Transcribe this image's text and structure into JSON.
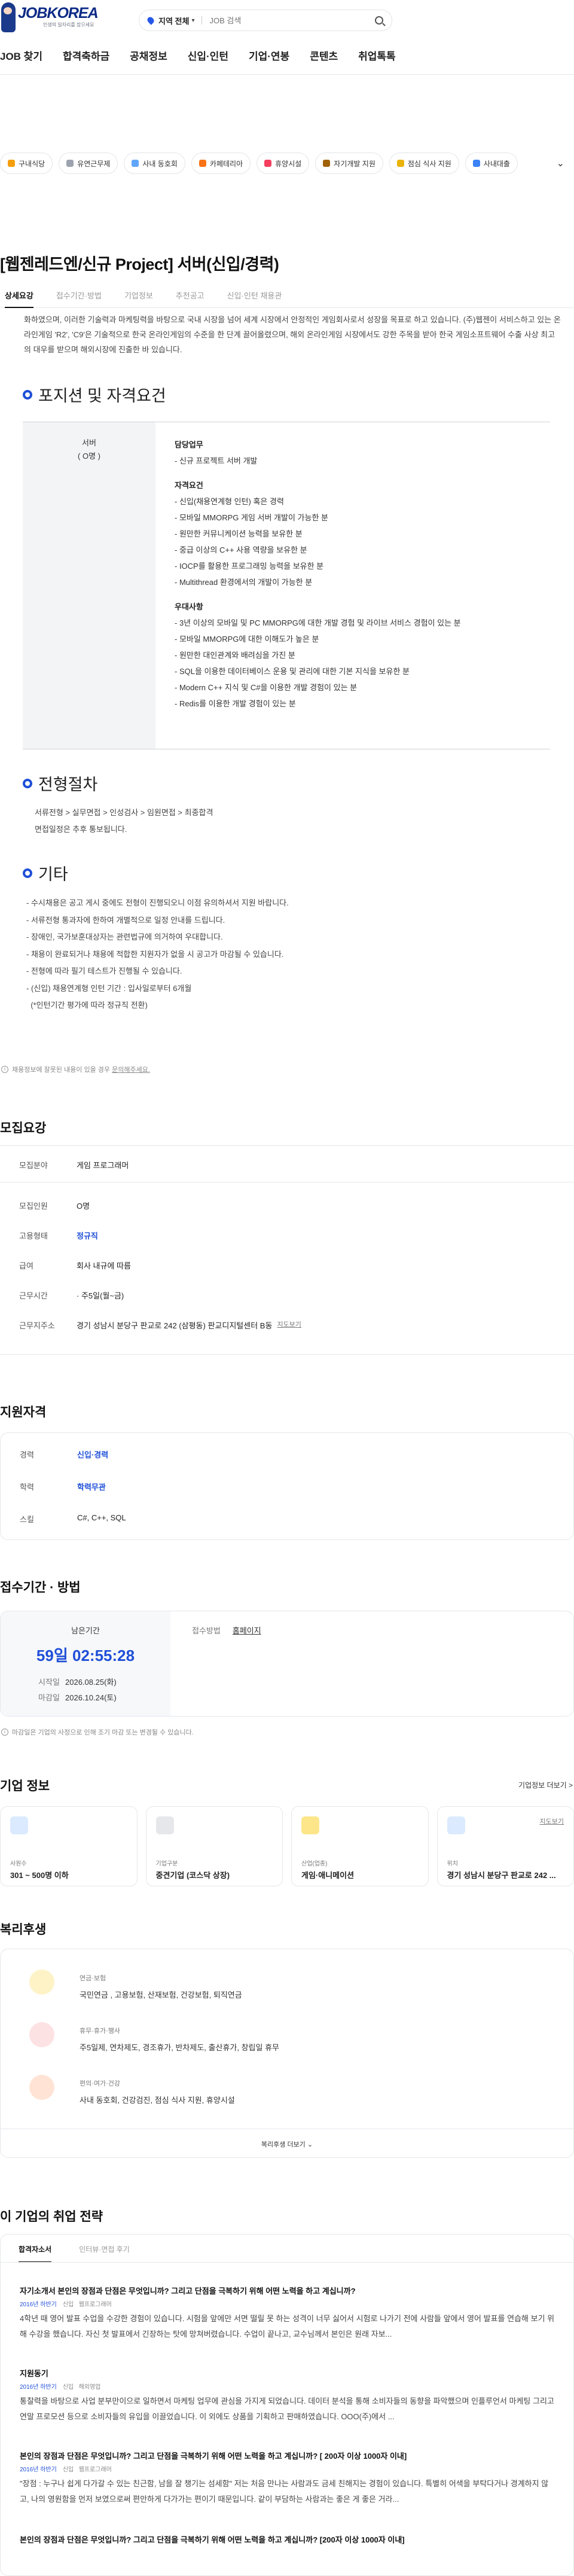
{
  "header": {
    "brand": "JOBKOREA",
    "brand_sub": "인생의 일자리를 잡으세요",
    "region_label": "지역 전체",
    "search_placeholder": "JOB 검색",
    "gnb": [
      "JOB 찾기",
      "합격축하금",
      "공채정보",
      "신입·인턴",
      "기업·연봉",
      "콘텐츠",
      "취업톡톡"
    ]
  },
  "chips": [
    {
      "label": "구내식당",
      "color": "#f59e0b"
    },
    {
      "label": "유연근무제",
      "color": "#9ca3af"
    },
    {
      "label": "사내 동호회",
      "color": "#60a5fa"
    },
    {
      "label": "카페테리아",
      "color": "#f97316"
    },
    {
      "label": "휴양시설",
      "color": "#f43f5e"
    },
    {
      "label": "자기개발 지원",
      "color": "#a16207"
    },
    {
      "label": "점심 식사 지원",
      "color": "#eab308"
    },
    {
      "label": "사내대출",
      "color": "#3b82f6"
    }
  ],
  "job": {
    "title": "[웹젠레드엔/신규 Project] 서버(신입/경력)",
    "tabs": [
      "상세요강",
      "접수기간·방법",
      "기업정보",
      "추천공고",
      "신입·인턴 채용관"
    ],
    "intro": "화하였으며, 이러한 기술력과 마케팅력을 바탕으로 국내 시장을 넘어 세계 시장에서 안정적인 게임회사로서 성장을 목표로 하고 있습니다. (주)웹젠이 서비스하고 있는 온라인게임 'R2', 'C9'은 기술적으로 한국 온라인게임의 수준을 한 단계 끌어올렸으며, 해외 온라인게임 시장에서도 강한 주목을 받아 한국 게임소프트웨어 수출 사상 최고의 대우를 받으며 해외시장에 진출한 바 있습니다.",
    "section_qual": "포지션 및 자격요건",
    "pos_name": "서버",
    "pos_count": "( O명 )",
    "duty_head": "담당업무",
    "duty": "- 신규 프로젝트 서버 개발",
    "qual_head": "자격요건",
    "quals": [
      "- 신입(채용연계형 인턴) 혹은 경력",
      "- 모바일 MMORPG 게임 서버 개발이 가능한 분",
      "- 원만한 커뮤니케이션 능력을 보유한 분",
      "- 중급 이상의 C++ 사용 역량을 보유한 분",
      "- IOCP를 활용한 프로그래밍 능력을 보유한 분",
      "- Multithread 환경에서의 개발이 가능한 분"
    ],
    "pref_head": "우대사항",
    "prefs": [
      "- 3년 이상의 모바일 및 PC MMORPG에 대한 개발 경험 및 라이브 서비스 경험이 있는 분",
      "- 모바일 MMORPG에 대한 이해도가 높은 분",
      "- 원만한 대인관계와 배려심을 가진 분",
      "- SQL을 이용한 데이터베이스 운용 및 관리에 대한 기본 지식을 보유한 분",
      "- Modern C++ 지식 및 C#을 이용한 개발 경험이 있는 분",
      "- Redis를 이용한 개발 경험이 있는 분"
    ],
    "section_proc": "전형절차",
    "proc": [
      "서류전형 > 실무면접 > 인성검사 > 임원면접 > 최종합격",
      "면접일정은 추후 통보됩니다."
    ],
    "section_etc": "기타",
    "etc": [
      "- 수시채용은 공고 게시 중에도 전형이 진행되오니 이점 유의하셔서 지원 바랍니다.",
      "- 서류전형 통과자에 한하여 개별적으로 일정 안내를 드립니다.",
      "- 장애인, 국가보훈대상자는 관련법규에 의거하여 우대합니다.",
      "- 채용이 완료되거나 채용에 적합한 지원자가 없을 시 공고가 마감될 수 있습니다.",
      "- 전형에 따라 필기 테스트가 진행될 수 있습니다.",
      "- (신입) 채용연계형 인턴 기간 : 입사일로부터 6개월",
      "  (*인턴기간 평가에 따라 정규직 전환)"
    ],
    "note": "채용정보에 잘못된 내용이 있을 경우",
    "note_link": "문의해주세요."
  },
  "summary": {
    "title": "모집요강",
    "rows": [
      {
        "k": "모집분야",
        "v": "게임 프로그래머"
      },
      {
        "k": "모집인원",
        "v": "O명"
      },
      {
        "k": "고용형태",
        "v": "정규직"
      },
      {
        "k": "급여",
        "v": "회사 내규에 따름"
      },
      {
        "k": "근무시간",
        "v": "· 주5일(월~금)"
      },
      {
        "k": "근무지주소",
        "v": "경기 성남시 분당구 판교로 242 (삼평동) 판교디지털센터 B동",
        "link": "지도보기"
      }
    ]
  },
  "qualify": {
    "title": "지원자격",
    "rows": [
      {
        "k": "경력",
        "v": "신입·경력"
      },
      {
        "k": "학력",
        "v": "학력무관"
      },
      {
        "k": "스킬",
        "v": "C#, C++, SQL"
      }
    ]
  },
  "apply": {
    "title": "접수기간 · 방법",
    "remain_label": "남은기간",
    "remain": "59일 02:55:28",
    "start_k": "시작일",
    "start_v": "2026.08.25(화)",
    "end_k": "마감일",
    "end_v": "2026.10.24(토)",
    "method_k": "접수방법",
    "method_v": "홈페이지",
    "note": "마감일은 기업의 사정으로 인해 조기 마감 또는 변경될 수 있습니다."
  },
  "company": {
    "title": "기업 정보",
    "more": "기업정보 더보기 >",
    "cards": [
      {
        "label": "사원수",
        "value": "301 ~ 500명 이하",
        "color": "#dbeafe"
      },
      {
        "label": "기업구분",
        "value": "중견기업 (코스닥 상장)",
        "color": "#e5e7eb"
      },
      {
        "label": "산업(업종)",
        "value": "게임·애니메이션",
        "color": "#fde68a"
      },
      {
        "label": "위치",
        "value": "경기 성남시 분당구 판교로 242 ...",
        "color": "#dbeafe",
        "map": "지도보기"
      }
    ]
  },
  "welfare": {
    "title": "복리후생",
    "items": [
      {
        "t": "연금·보험",
        "d": "국민연금 , 고용보험, 산재보험, 건강보험, 퇴직연금",
        "color": "#fef3c7"
      },
      {
        "t": "휴무·휴가·행사",
        "d": "주5일제, 연차제도, 경조휴가, 반차제도, 출산휴가, 창립일 휴무",
        "color": "#fde2e4"
      },
      {
        "t": "편의·여가·건강",
        "d": "사내 동호회, 건강검진, 점심 식사 지원, 휴양시설",
        "color": "#ffe4d6"
      }
    ],
    "more": "복리후생 더보기"
  },
  "strategy": {
    "title": "이 기업의 취업 전략",
    "tabs": [
      "합격자소서",
      "인터뷰·면접 후기"
    ],
    "entries": [
      {
        "q": "자기소개서 본인의 장점과 단점은 무엇입니까? 그리고 단점을 극복하기 위해 어떤 노력을 하고 계십니까?",
        "year": "2016년 하반기",
        "type": "신입",
        "job": "웹프로그래머",
        "a": "4학년 때 영어 발표 수업을 수강한 경험이 있습니다. 시험을 앞에만 서면 떨릴 못 하는 성격이 너무 싫어서 시험로 나가기 전에 사람들 앞에서 영어 발표를 연습해 보기 위해 수강을 했습니다. 자신 첫 발표에서 긴장하는 탓에 망쳐버렸습니다. 수업이 끝나고, 교수님께서 본인은 원래 자보..."
      },
      {
        "q": "지원동기",
        "year": "2016년 하반기",
        "type": "신입",
        "job": "해외영업",
        "a": "통찰력을 바탕으로 사업 분부만이으로 일하면서 마케팅 업무에 관심을 가지게 되었습니다. 데이터 분석을 통해 소비자들의 동향을 파악했으며 인플루언서 마케팅 그리고 연말 프로모션 등으로 소비자들의 유입을 이끌었습니다. 이 외에도 상품을 기획하고 판매하였습니다. OOO(주)에서 ..."
      },
      {
        "q": "본인의 장점과 단점은 무엇입니까? 그리고 단점을 극복하기 위해 어떤 노력을 하고 계십니까? [ 200자 이상 1000자 이내]",
        "year": "2016년 하반기",
        "type": "신입",
        "job": "웹프로그래머",
        "a": "\"장점 : 누구나 쉽게 다가갈 수 있는 친근함, 남을 잘 챙기는 섬세함\" 저는 처음 만나는 사람과도 금세 친해지는 경험이 있습니다. 특별히 어색을 부탁다거나 경계하지 않고, 나의 영원함을 먼저 보였으로써 편안하게 다가가는 편이기 때문입니다. 같이 부담하는 사람과는 좋은 게 좋은 거라..."
      },
      {
        "q": "본인의 장점과 단점은 무엇입니까? 그리고 단점을 극복하기 위해 어떤 노력을 하고 계십니까? [200자 이상 1000자 이내]",
        "year": "",
        "type": "",
        "job": "",
        "a": ""
      }
    ]
  }
}
